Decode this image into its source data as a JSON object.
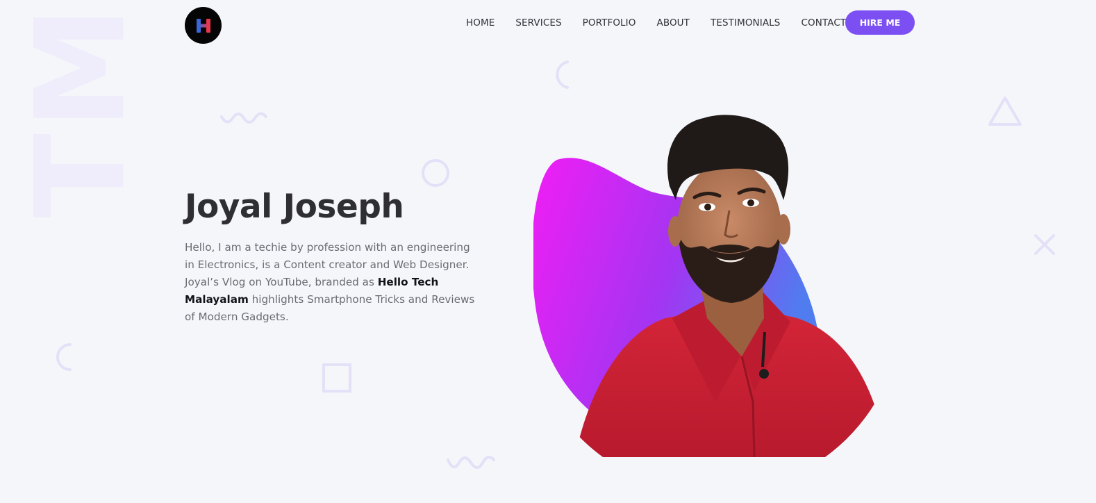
{
  "watermark": {
    "text": "HTML"
  },
  "logo": {
    "letter": "H",
    "colors": {
      "left": "#3a66d6",
      "right": "#e8374c"
    }
  },
  "nav": {
    "items": [
      "HOME",
      "SERVICES",
      "PORTFOLIO",
      "ABOUT",
      "TESTIMONIALS",
      "CONTACT"
    ],
    "cta": "HIRE ME"
  },
  "hero": {
    "name": "Joyal Joseph",
    "desc_1": "Hello, I am a techie by profession with an engineering in Electronics, is a Content creator and Web Designer. Joyal’s Vlog on YouTube, branded as ",
    "desc_bold": "Hello Tech Malayalam",
    "desc_2": " highlights Smartphone Tricks and Reviews of Modern Gadgets."
  },
  "colors": {
    "accent": "#7b4ff2",
    "blob_start": "#f21df5",
    "blob_end": "#4f7df0",
    "shirt": "#c81e32",
    "deco": "#e4e0f7"
  }
}
